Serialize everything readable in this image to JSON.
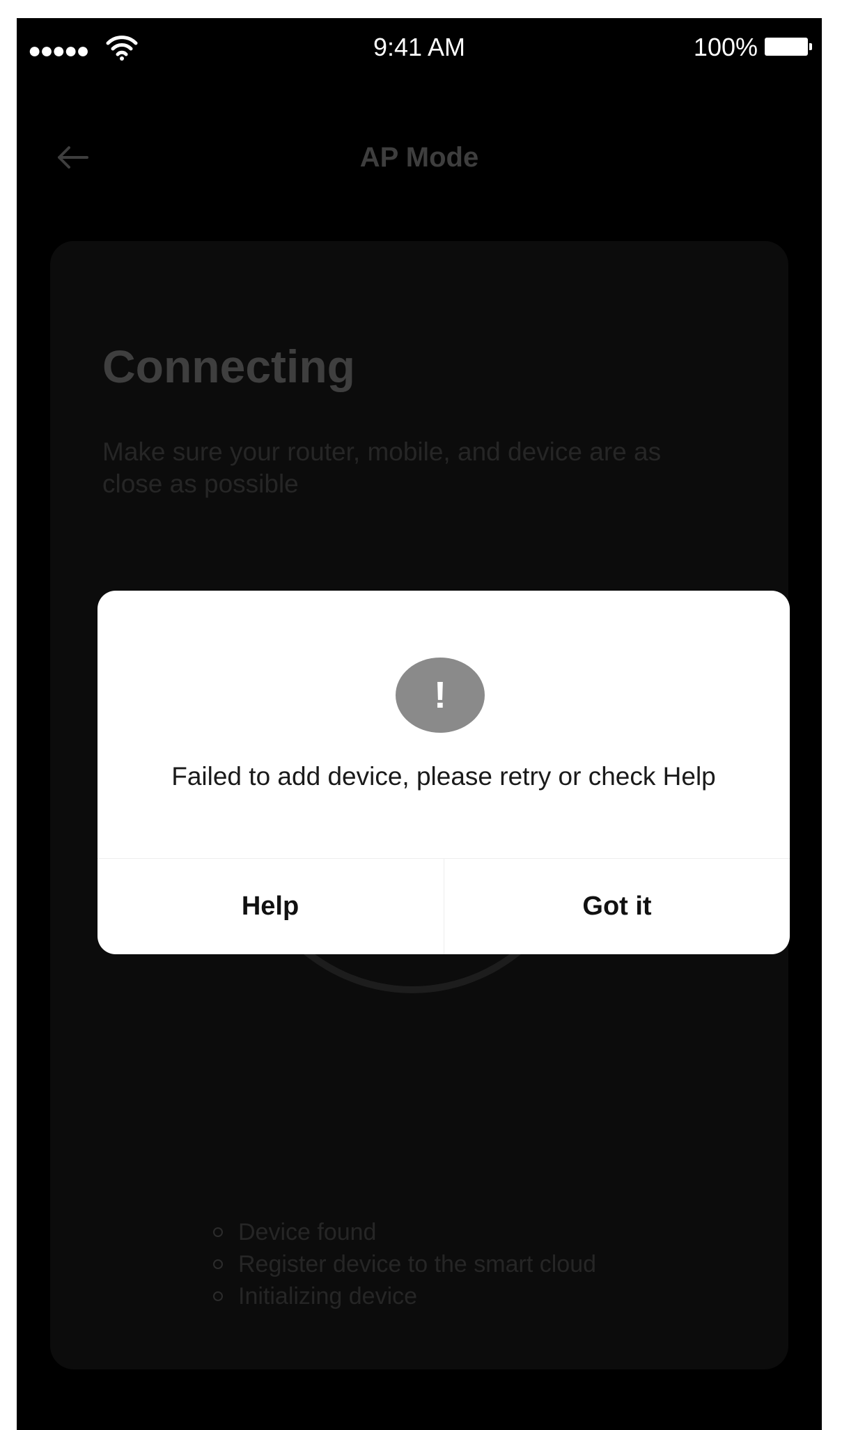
{
  "status_bar": {
    "signal": "●●●●●",
    "time": "9:41 AM",
    "battery": "100%"
  },
  "nav": {
    "title": "AP Mode",
    "back_icon": "arrow-left-icon"
  },
  "screen": {
    "heading": "Connecting",
    "subtext": "Make sure your router, mobile, and device are as close as possible",
    "steps": [
      {
        "label": "Device found"
      },
      {
        "label": "Register device to the smart cloud"
      },
      {
        "label": "Initializing device"
      }
    ]
  },
  "dialog": {
    "icon": "exclamation-icon",
    "icon_glyph": "!",
    "message": "Failed to add device, please retry or check Help",
    "help_label": "Help",
    "gotit_label": "Got it"
  },
  "colors": {
    "background": "#000000",
    "dialog": "#ffffff",
    "alert_icon": "#8a8a8a"
  }
}
